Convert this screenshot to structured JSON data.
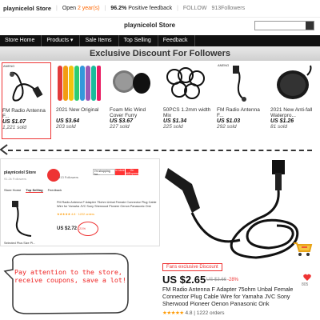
{
  "topbar": {
    "store_name": "playnicelol Store",
    "open_prefix": "Open",
    "open_years": "2 year(s)",
    "feedback_pct": "96.2%",
    "feedback_label": "Positive feedback",
    "follow_label": "FOLLOW",
    "followers": "913Followers"
  },
  "logo": "playnicelol Store",
  "nav": [
    "Store Home",
    "Products ▾",
    "Sale Items",
    "Top Selling",
    "Feedback"
  ],
  "banner": "Exclusive Discount For Followers",
  "products": [
    {
      "name": "FM Radio Antenna F...",
      "price": "US $1.07",
      "sold": "1,221 sold",
      "brand": "ANENG"
    },
    {
      "name": "2021 New Original",
      "price": "US $3.64",
      "sold": "203 sold"
    },
    {
      "name": "Foam Mic Wind Cover Furry",
      "price": "US $3.67",
      "sold": "227 sold"
    },
    {
      "name": "50PCS 1.2mm width Mix",
      "price": "US $1.34",
      "sold": "225 sold"
    },
    {
      "name": "FM Radio Antenna F...",
      "price": "US $1.03",
      "sold": "292 sold",
      "brand": "ANENG"
    },
    {
      "name": "2021 New Anti-fall Waterpro...",
      "price": "US $1.26",
      "sold": "81 sold"
    }
  ],
  "screenshot": {
    "store_name": "playnicelol Store",
    "store_sub": "91.2k Followers",
    "follow_count": "913 Followers",
    "tabs": [
      "Store Home",
      "Top Selling",
      "Feedback"
    ],
    "search_placeholder": "I'm shopping for...",
    "search_btn": "In store",
    "search_btn2": "On AliExpress",
    "desc": "FM Radio Antenna F Adapter 75ohm Unbal Female Connector Plug Cable Wire for Yamaha JVC Sony Sherwood Pioneer Oenon Panasonic Onk",
    "rating": "★★★★★ 4.8 · 1222 orders",
    "price": "US $2.72",
    "pct": "-21%",
    "wish": "Selected Plus Size Pl..."
  },
  "main_product": {
    "discount_tag": "Fans exclusive Discount",
    "price": "US $2.65",
    "old_price": "US $3.66",
    "pct_off": "-28%",
    "wish_count": "805",
    "title": "FM Radio Antenna F Adapter 75ohm Unbal Female Connector Plug Cable Wire for Yamaha JVC Sony Sherwood Pioneer Oenon Panasonic Onk",
    "stars": "★★★★★",
    "rating": "4.8 | 1222 orders"
  },
  "bubble_text": "Pay attention to the store, receive coupons, save a lot!",
  "colors": {
    "accent": "#e33333",
    "nav_bg": "#111111",
    "orange": "#ff6600"
  }
}
